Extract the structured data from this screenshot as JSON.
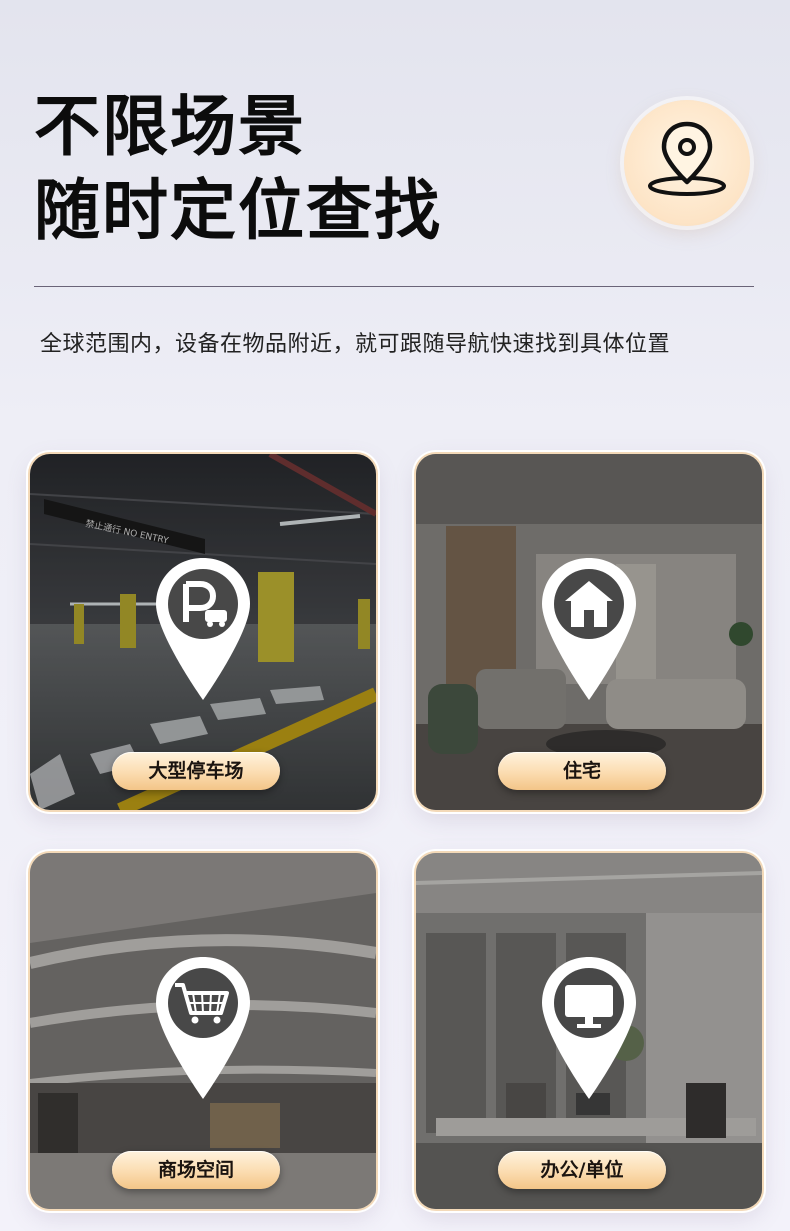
{
  "header": {
    "title_line1": "不限场景",
    "title_line2": "随时定位查找",
    "subtitle": "全球范围内，设备在物品附近，就可跟随导航快速找到具体位置"
  },
  "badge": {
    "icon": "location-pin-icon"
  },
  "scenes": [
    {
      "label": "大型停车场",
      "icon": "parking-icon",
      "sign_text": "禁止通行 NO ENTRY"
    },
    {
      "label": "住宅",
      "icon": "house-icon"
    },
    {
      "label": "商场空间",
      "icon": "shopping-cart-icon"
    },
    {
      "label": "办公/单位",
      "icon": "monitor-icon"
    }
  ],
  "colors": {
    "accent": "#f6cf99",
    "pin": "#ffffff",
    "pin_inner": "#4a4a4a"
  }
}
